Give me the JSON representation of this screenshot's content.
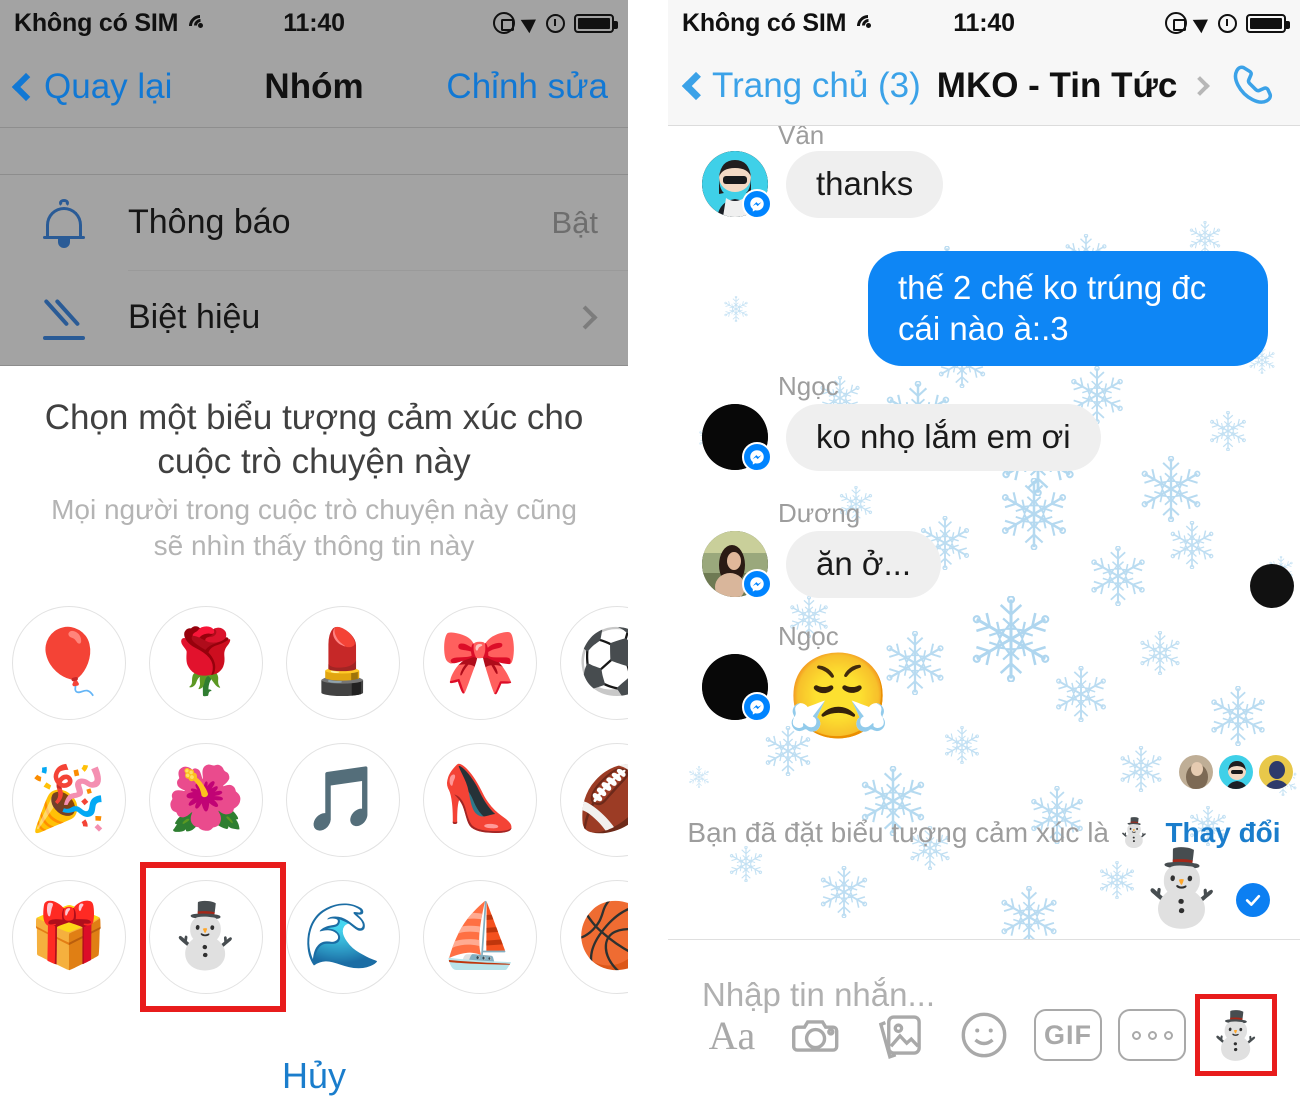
{
  "left": {
    "status": {
      "carrier": "Không có SIM",
      "time": "11:40",
      "wifi_icon": "wifi-icon",
      "lock_icon": "rotation-lock-icon",
      "location_icon": "location-arrow-icon",
      "alarm_icon": "alarm-clock-icon",
      "battery_icon": "battery-full-icon"
    },
    "nav": {
      "back_label": "Quay lại",
      "title": "Nhóm",
      "edit_label": "Chỉnh sửa"
    },
    "settings": [
      {
        "icon": "bell-icon",
        "label": "Thông báo",
        "value": "Bật"
      },
      {
        "icon": "pencil-icon",
        "label": "Biệt hiệu",
        "value": ""
      }
    ],
    "sheet": {
      "title": "Chọn một biểu tượng cảm xúc cho cuộc trò chuyện này",
      "subtitle": "Mọi người trong cuộc trò chuyện này cũng sẽ nhìn thấy thông tin này",
      "cancel_label": "Hủy",
      "selected_index": 11,
      "emojis": [
        {
          "glyph": "🎈",
          "name": "balloon"
        },
        {
          "glyph": "🌹",
          "name": "rose"
        },
        {
          "glyph": "💄",
          "name": "lipstick"
        },
        {
          "glyph": "🎀",
          "name": "ribbon"
        },
        {
          "glyph": "⚽",
          "name": "soccer-ball"
        },
        {
          "glyph": "🎉",
          "name": "party-popper"
        },
        {
          "glyph": "🌺",
          "name": "hibiscus"
        },
        {
          "glyph": "🎵",
          "name": "music-notes"
        },
        {
          "glyph": "👠",
          "name": "high-heel"
        },
        {
          "glyph": "🏈",
          "name": "american-football"
        },
        {
          "glyph": "🎁",
          "name": "gift"
        },
        {
          "glyph": "⛄",
          "name": "snowman"
        },
        {
          "glyph": "🌊",
          "name": "wave"
        },
        {
          "glyph": "⛵",
          "name": "sailboat"
        },
        {
          "glyph": "🏀",
          "name": "basketball"
        }
      ]
    }
  },
  "right": {
    "status": {
      "carrier": "Không có SIM",
      "time": "11:40"
    },
    "nav": {
      "back_label": "Trang chủ (3)",
      "thread_title": "MKO - Tin Tức",
      "call_icon": "phone-icon"
    },
    "messages": [
      {
        "sender": "Vân",
        "text": "thanks",
        "side": "in",
        "avatar": "girl-sunglasses",
        "partial_name": true
      },
      {
        "sender": "",
        "text": "thế 2 chế ko trúng đc cái nào à:.3",
        "side": "out"
      },
      {
        "sender": "Ngọc",
        "text": "ko nhọ lắm em ơi",
        "side": "in",
        "avatar": "black"
      },
      {
        "sender": "Dương",
        "text": "ăn ở...",
        "side": "in",
        "avatar": "girl-photo"
      },
      {
        "sender": "Ngọc",
        "text": "😤",
        "side": "in",
        "avatar": "black",
        "is_emoji": true
      }
    ],
    "reaction_note": {
      "text": "Bạn đã đặt biểu tượng cảm xúc là",
      "emoji": "⛄",
      "change_label": "Thay đổi"
    },
    "sticker_preview": {
      "emoji": "⛄",
      "check_icon": "check-circle-icon"
    },
    "composer": {
      "placeholder": "Nhập tin nhắn..."
    },
    "toolbar": [
      {
        "name": "text-format-icon",
        "label": "Aa"
      },
      {
        "name": "camera-icon",
        "label": ""
      },
      {
        "name": "photos-icon",
        "label": ""
      },
      {
        "name": "sticker-smiley-icon",
        "label": ""
      },
      {
        "name": "gif-icon",
        "label": "GIF"
      },
      {
        "name": "more-options-icon",
        "label": ""
      },
      {
        "name": "snowman-theme-icon",
        "label": "⛄"
      }
    ]
  },
  "colors": {
    "accent_blue": "#0e86f5",
    "link_blue": "#1a7dcc",
    "highlight_red": "#e81c1c",
    "bubble_gray": "#efefef",
    "panel_gray": "#a3a3a3",
    "snow_blue": "#aed6ef"
  }
}
